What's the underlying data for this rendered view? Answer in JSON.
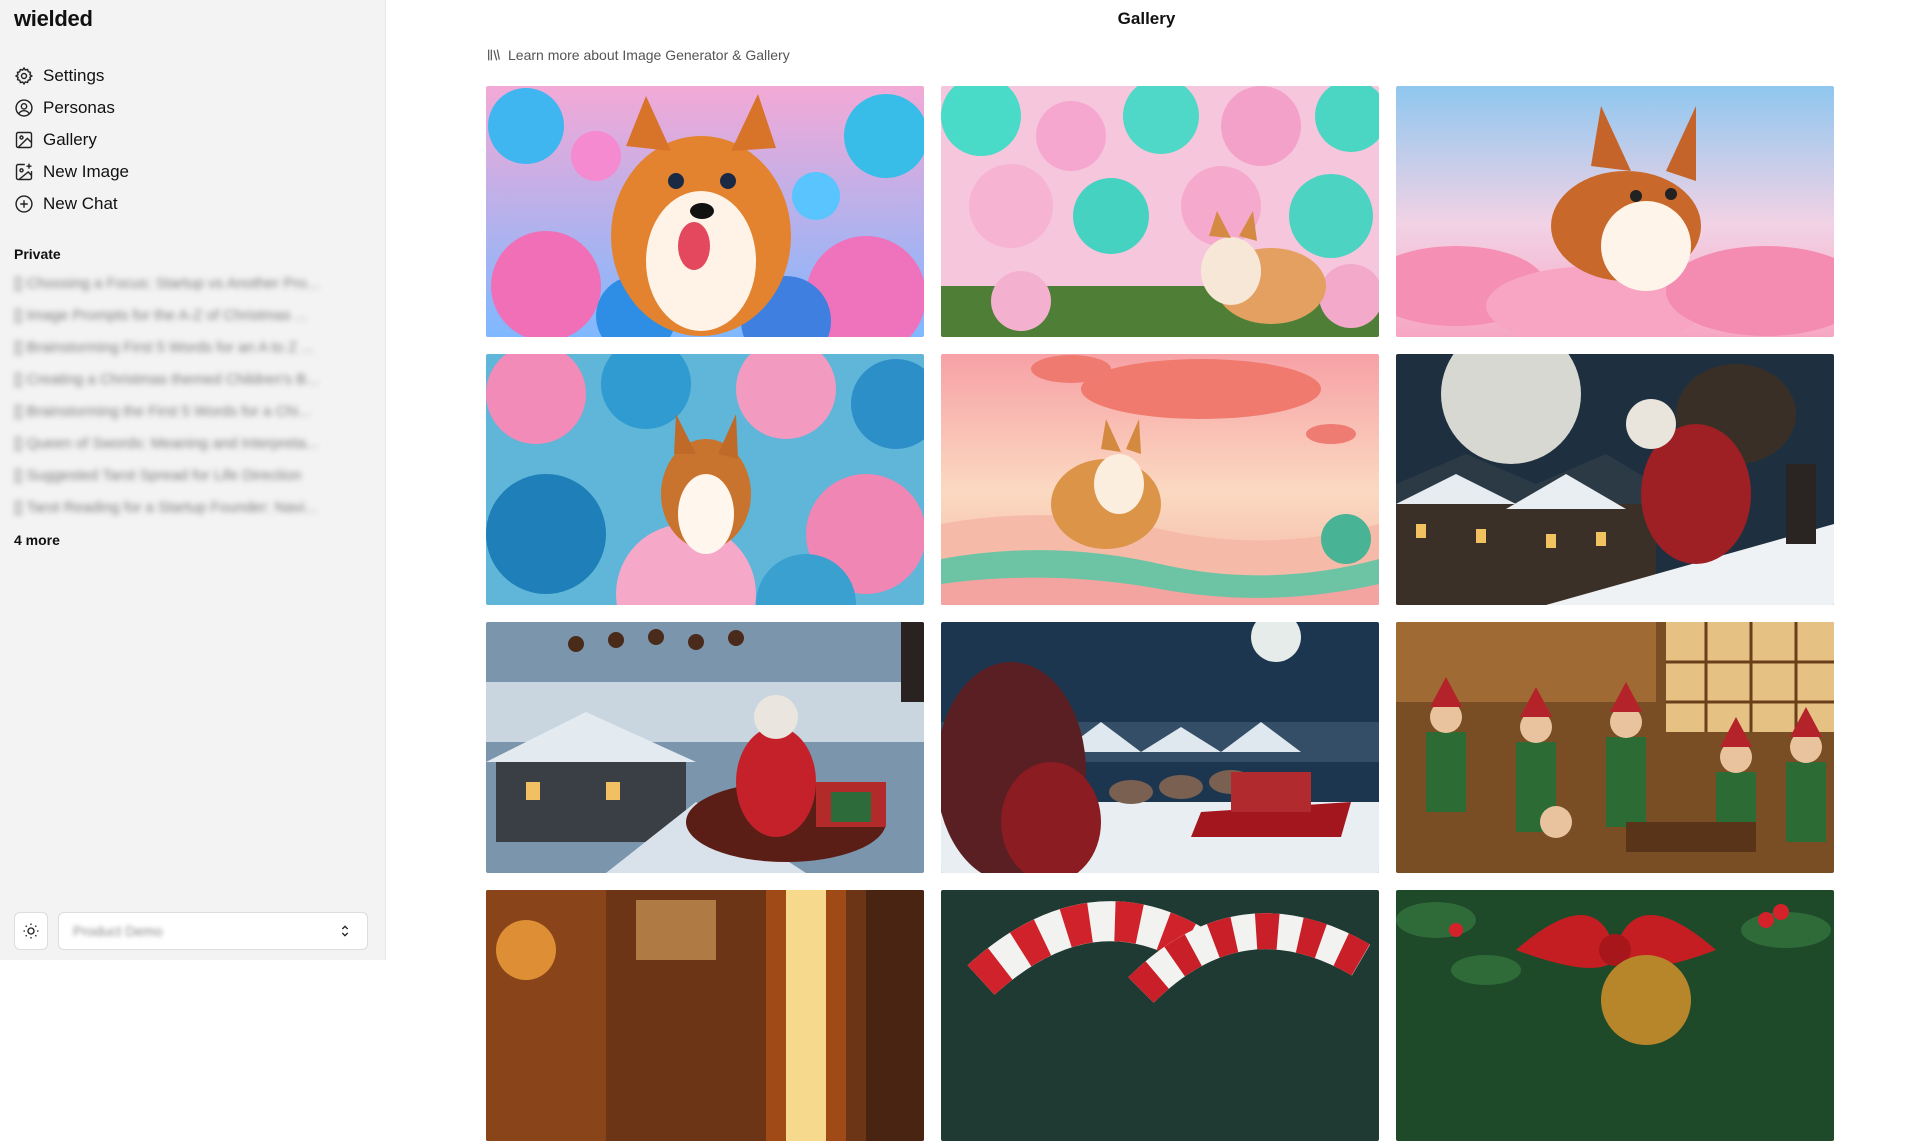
{
  "app": {
    "brand": "wielded"
  },
  "nav": [
    {
      "label": "Settings",
      "icon": "gear-icon"
    },
    {
      "label": "Personas",
      "icon": "user-circle-icon"
    },
    {
      "label": "Gallery",
      "icon": "image-icon"
    },
    {
      "label": "New Image",
      "icon": "image-plus-icon"
    },
    {
      "label": "New Chat",
      "icon": "plus-circle-icon"
    }
  ],
  "history": {
    "section_label": "Private",
    "items": [
      "[] Choosing a Focus: Startup vs Another Pro...",
      "[] Image Prompts for the A-Z of Christmas ...",
      "[] Brainstorming First 5 Words for an A to Z ...",
      "[] Creating a Christmas themed Children's B...",
      "[] Brainstorming the First 5 Words for a Chi...",
      "[] Queen of Swords: Meaning and Interpreta...",
      "[] Suggested Tarot Spread for Life Direction",
      "[] Tarot Reading for a Startup Founder: Navi..."
    ],
    "more_label": "4 more"
  },
  "footer": {
    "persona_value": "Product Demo"
  },
  "main": {
    "title": "Gallery",
    "learn_more": "Learn more about Image Generator & Gallery"
  },
  "gallery": [
    {
      "theme": "corgi-cotton-candy-closeup"
    },
    {
      "theme": "corgi-cotton-candy-field"
    },
    {
      "theme": "corgi-pink-clouds-leaping"
    },
    {
      "theme": "corgi-blue-pink-clouds"
    },
    {
      "theme": "corgi-sunset-dunes"
    },
    {
      "theme": "santa-rooftop-moon"
    },
    {
      "theme": "santa-sleigh-rooftop"
    },
    {
      "theme": "santa-sleigh-night-village"
    },
    {
      "theme": "elves-workshop"
    },
    {
      "theme": "cozy-fireplace-room"
    },
    {
      "theme": "candy-canes"
    },
    {
      "theme": "red-ribbon-holly"
    }
  ]
}
